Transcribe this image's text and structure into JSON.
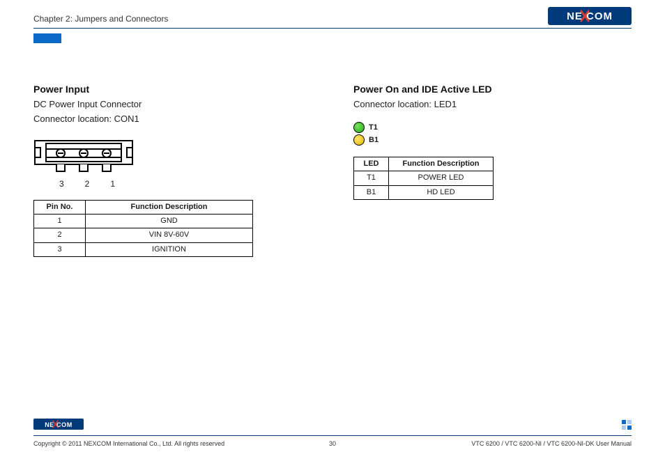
{
  "header": {
    "chapter": "Chapter 2: Jumpers and Connectors",
    "brand": "NEXCOM"
  },
  "left": {
    "title": "Power Input",
    "sub1": "DC Power Input Connector",
    "sub2": "Connector location: CON1",
    "pin_labels": [
      "3",
      "2",
      "1"
    ],
    "table": {
      "head": [
        "Pin  No.",
        "Function Description"
      ],
      "rows": [
        [
          "1",
          "GND"
        ],
        [
          "2",
          "VIN 8V-60V"
        ],
        [
          "3",
          "IGNITION"
        ]
      ]
    }
  },
  "right": {
    "title": "Power On and IDE Active LED",
    "sub1": "Connector location: LED1",
    "leds": [
      {
        "name": "T1",
        "color": "green"
      },
      {
        "name": "B1",
        "color": "yellow"
      }
    ],
    "table": {
      "head": [
        "LED",
        "Function Description"
      ],
      "rows": [
        [
          "T1",
          "POWER LED"
        ],
        [
          "B1",
          "HD LED"
        ]
      ]
    }
  },
  "footer": {
    "copyright": "Copyright © 2011 NEXCOM International Co., Ltd. All rights reserved",
    "page": "30",
    "doc": "VTC 6200 / VTC 6200-NI / VTC 6200-NI-DK User Manual"
  }
}
